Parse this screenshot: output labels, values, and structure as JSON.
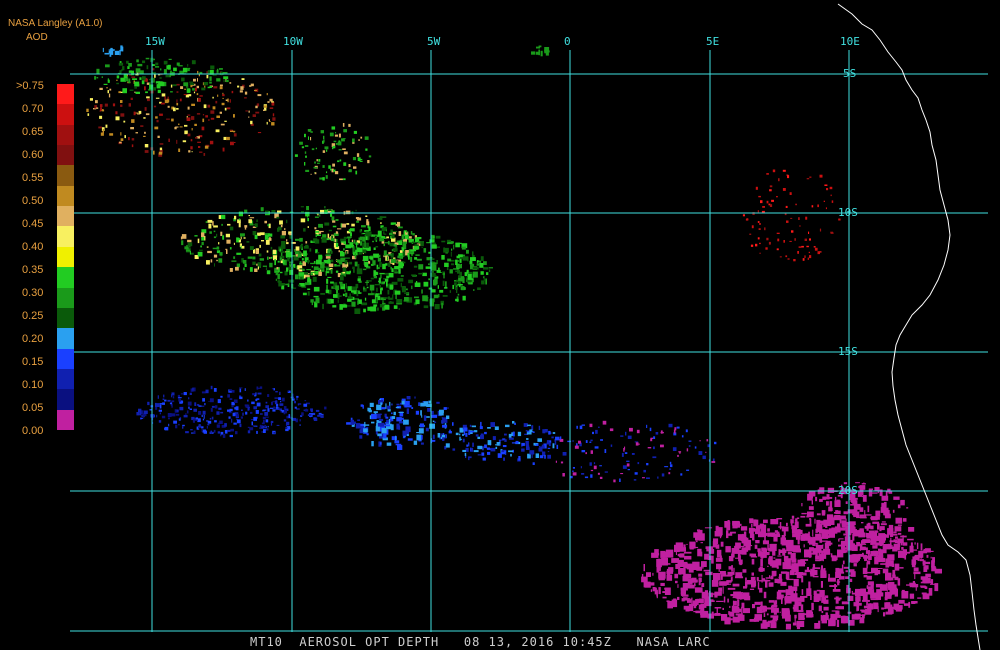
{
  "header": {
    "product": "NASA Langley (A1.0)",
    "parameter": "AOD"
  },
  "legend": {
    "labels": [
      ">0.75",
      "0.70",
      "0.65",
      "0.60",
      "0.55",
      "0.50",
      "0.45",
      "0.40",
      "0.35",
      "0.30",
      "0.25",
      "0.20",
      "0.15",
      "0.10",
      "0.05",
      "0.00"
    ],
    "colors": [
      "#ff1a1a",
      "#cc1010",
      "#a01010",
      "#801010",
      "#8a5a10",
      "#c08a20",
      "#e0b060",
      "#f8f060",
      "#f0f000",
      "#22cc22",
      "#1a9a1a",
      "#0a5a0a",
      "#2aa0f0",
      "#1a40ff",
      "#1020b0",
      "#0a1080",
      "#c020a0"
    ]
  },
  "map": {
    "longitude_labels": [
      "15W",
      "10W",
      "5W",
      "0",
      "5E",
      "10E"
    ],
    "latitude_labels": [
      "5S",
      "10S",
      "15S",
      "20S"
    ],
    "grid_color": "#40e0e0",
    "coast_color": "#ffffff"
  },
  "footer": {
    "text": "MT10  AEROSOL OPT DEPTH   08 13, 2016 10:45Z   NASA LARC"
  }
}
